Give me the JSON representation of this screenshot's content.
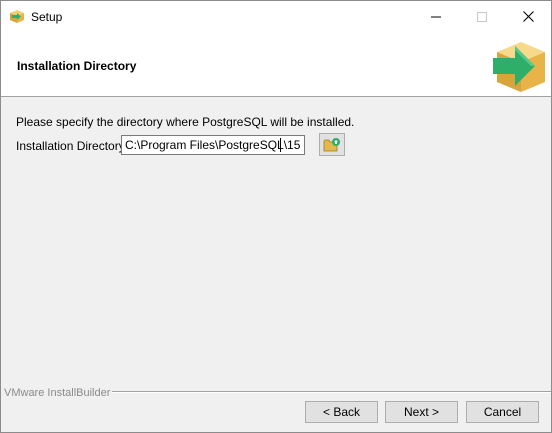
{
  "window": {
    "title": "Setup",
    "controls": {
      "minimize_icon": "minimize-icon",
      "maximize_icon": "maximize-icon",
      "close_icon": "close-icon"
    }
  },
  "header": {
    "title": "Installation Directory",
    "logo_icon": "installer-box-arrow-icon"
  },
  "main": {
    "prompt": "Please specify the directory where PostgreSQL will be installed.",
    "directory_label": "Installation Directory",
    "directory_value": "C:\\Program Files\\PostgreSQL\\15",
    "browse_icon": "folder-browse-icon"
  },
  "footer": {
    "brand": "VMware InstallBuilder",
    "back_label": "< Back",
    "next_label": "Next >",
    "cancel_label": "Cancel"
  },
  "colors": {
    "window_bg": "#f0f0f0",
    "header_bg": "#ffffff",
    "logo_green": "#3cb371",
    "logo_box": "#e8b44a"
  }
}
